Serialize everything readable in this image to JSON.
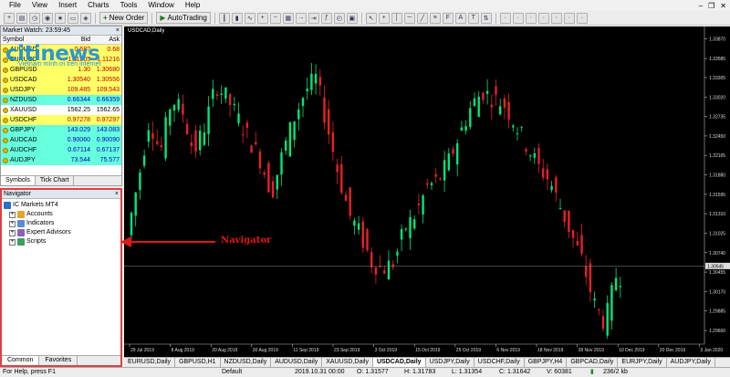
{
  "menu": [
    "File",
    "View",
    "Insert",
    "Charts",
    "Tools",
    "Window",
    "Help"
  ],
  "toolbar": {
    "new_order": "New Order",
    "auto_trading": "AutoTrading"
  },
  "market_watch": {
    "title": "Market Watch: 23:59:45",
    "columns": [
      "Symbol",
      "Bid",
      "Ask"
    ],
    "rows": [
      {
        "symbol": "AUDUSD",
        "bid": "0.68?",
        "ask": "0.68",
        "color": "yellow"
      },
      {
        "symbol": "EURUSD",
        "bid": "1.11205",
        "ask": "1.11216",
        "color": "yellow"
      },
      {
        "symbol": "GBPUSD",
        "bid": "1.30",
        "ask": "1.30680",
        "color": "yellow"
      },
      {
        "symbol": "USDCAD",
        "bid": "1.30540",
        "ask": "1.30556",
        "color": "yellow"
      },
      {
        "symbol": "USDJPY",
        "bid": "109.485",
        "ask": "109.543",
        "color": "yellow"
      },
      {
        "symbol": "NZDUSD",
        "bid": "0.66344",
        "ask": "0.66359",
        "color": "cyan"
      },
      {
        "symbol": "XAUUSD",
        "bid": "1562.25",
        "ask": "1562.65",
        "color": "white"
      },
      {
        "symbol": "USDCHF",
        "bid": "0.97278",
        "ask": "0.97297",
        "color": "yellow"
      },
      {
        "symbol": "GBPJPY",
        "bid": "143.029",
        "ask": "143.083",
        "color": "cyan"
      },
      {
        "symbol": "AUDCAD",
        "bid": "0.90060",
        "ask": "0.90090",
        "color": "cyan"
      },
      {
        "symbol": "AUDCHF",
        "bid": "0.67114",
        "ask": "0.67137",
        "color": "cyan"
      },
      {
        "symbol": "AUDJPY",
        "bid": "73.544",
        "ask": "75.577",
        "color": "cyan"
      }
    ],
    "tabs": [
      "Symbols",
      "Tick Chart"
    ]
  },
  "watermark": {
    "main": "citinews",
    "sub": "Vietnam mình ơi trên internet"
  },
  "navigator": {
    "title": "Navigator",
    "root": "IC Markets MT4",
    "items": [
      "Accounts",
      "Indicators",
      "Expert Advisors",
      "Scripts"
    ],
    "tabs": [
      "Common",
      "Favorites"
    ]
  },
  "annotation": {
    "label": "Navigator"
  },
  "chart": {
    "title": "USDCAD,Daily",
    "current_price": "1.30545",
    "price_labels": [
      "1.33870",
      "1.33585",
      "1.33305",
      "1.33020",
      "1.32735",
      "1.32450",
      "1.32165",
      "1.31880",
      "1.31595",
      "1.31310",
      "1.31025",
      "1.30740",
      "1.30455",
      "1.30170",
      "1.29885",
      "1.29600"
    ],
    "date_labels": [
      "29 Jul 2019",
      "8 Aug 2019",
      "20 Aug 2019",
      "30 Aug 2019",
      "11 Sep 2019",
      "23 Sep 2019",
      "3 Oct 2019",
      "15 Oct 2019",
      "25 Oct 2019",
      "6 Nov 2019",
      "18 Nov 2019",
      "28 Nov 2019",
      "10 Dec 2019",
      "20 Dec 2019",
      "3 Jan 2020"
    ]
  },
  "chart_tabs": [
    "EURUSD,Daily",
    "GBPUSD,H1",
    "NZDUSD,Daily",
    "AUDUSD,Daily",
    "XAUUSD,Daily",
    "USDCAD,Daily",
    "USDJPY,Daily",
    "USDCHF,Daily",
    "GBPJPY,H4",
    "GBPCAD,Daily",
    "EURJPY,Daily",
    "AUDJPY,Daily"
  ],
  "status": {
    "help": "For Help, press F1",
    "profile": "Default",
    "time": "2019.10.31 00:00",
    "open": "O: 1.31577",
    "high": "H: 1.31783",
    "low": "L: 1.31354",
    "close": "C: 1.31642",
    "volume": "V: 60381",
    "traffic": "236/2 kb"
  },
  "colors": {
    "bull": "#00e67a",
    "bear": "#e8202a",
    "background": "#000000",
    "annotation": "#e01818"
  }
}
